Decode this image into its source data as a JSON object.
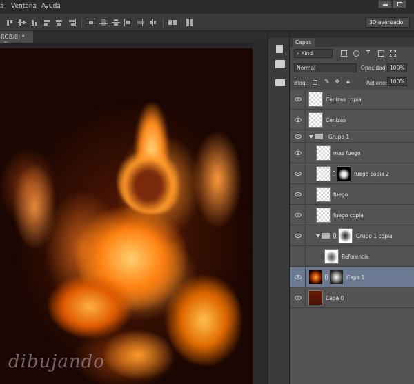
{
  "menu": {
    "item_partial": "a",
    "window": "Ventana",
    "help": "Ayuda"
  },
  "options_bar": {
    "workspace": "3D avanzado"
  },
  "document": {
    "tab_title": "RGB/8) *",
    "close": "×",
    "watermark": "dibujando"
  },
  "layers_panel": {
    "tab": "Capas",
    "filter_kind": "Kind",
    "blend_mode": "Normal",
    "opacity_label": "Opacidad:",
    "opacity_value": "100%",
    "lock_label": "Bloq.:",
    "fill_label": "Relleno:",
    "fill_value": "100%",
    "layers": [
      {
        "name": "Cenizas copia"
      },
      {
        "name": "Cenizas"
      },
      {
        "name": "Grupo 1"
      },
      {
        "name": "mas fuego"
      },
      {
        "name": "fuego copia 2"
      },
      {
        "name": "fuego"
      },
      {
        "name": "fuego copia"
      },
      {
        "name": "Grupo 1 copia"
      },
      {
        "name": "Referencia"
      },
      {
        "name": "Capa 1"
      },
      {
        "name": "Capa 0"
      }
    ],
    "selected_layer": "Capa 1"
  },
  "colors": {
    "selected_row": "#6b7a92",
    "panel_bg": "#535353",
    "flame": "#ff8a1c"
  }
}
